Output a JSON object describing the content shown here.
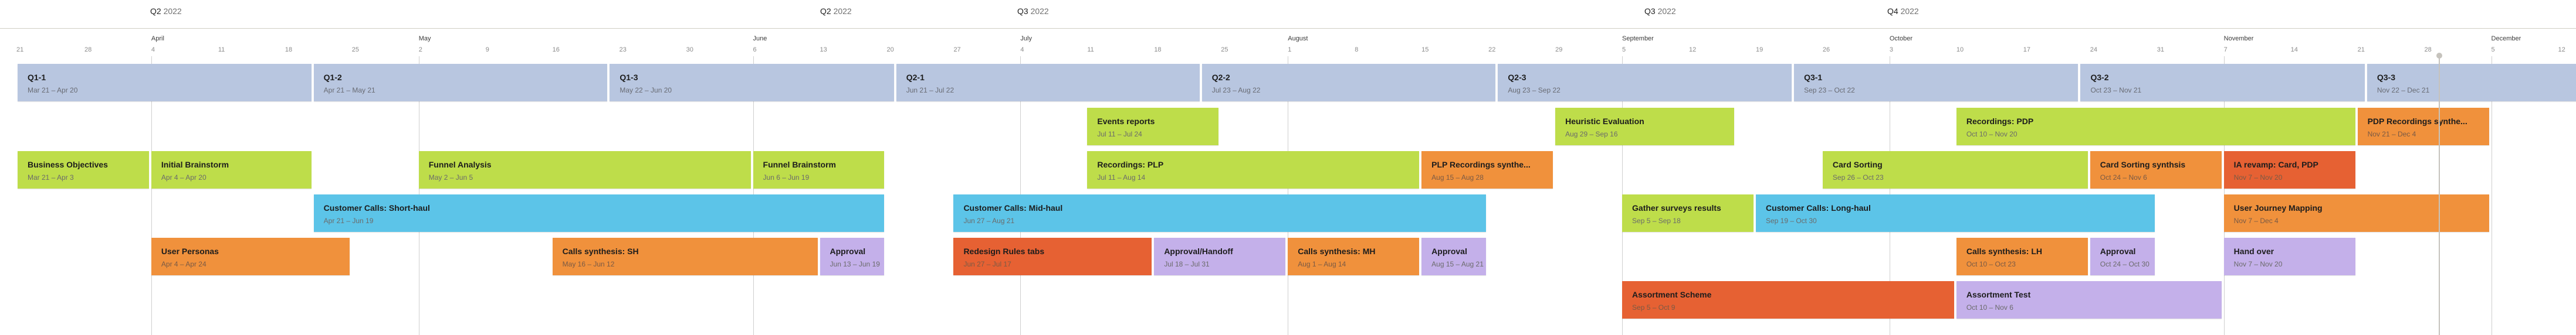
{
  "timeline": {
    "origin_date": "Mar 21",
    "colors": {
      "sprint": "#b8c6e0",
      "green": "#bedd4a",
      "blue": "#5cc4e8",
      "orange": "#f0913c",
      "red": "#e66133",
      "purple": "#c4b0ea"
    },
    "quarters": [
      {
        "q": "Q2",
        "year": "2022",
        "day": 0
      },
      {
        "q": "Q2",
        "year": "2022",
        "day": 77
      },
      {
        "q": "Q3",
        "year": "2022",
        "day": 105
      },
      {
        "q": "Q3",
        "year": "2022",
        "day": 182
      },
      {
        "q": "Q4",
        "year": "2022",
        "day": 196
      }
    ],
    "months": [
      {
        "label": "April",
        "day": 14
      },
      {
        "label": "May",
        "day": 42
      },
      {
        "label": "June",
        "day": 77
      },
      {
        "label": "July",
        "day": 105
      },
      {
        "label": "August",
        "day": 133
      },
      {
        "label": "September",
        "day": 168
      },
      {
        "label": "October",
        "day": 196
      },
      {
        "label": "November",
        "day": 231
      },
      {
        "label": "December",
        "day": 259
      }
    ],
    "weeks": [
      "21",
      "28",
      "4",
      "11",
      "18",
      "25",
      "2",
      "9",
      "16",
      "23",
      "30",
      "6",
      "13",
      "20",
      "27",
      "4",
      "11",
      "18",
      "25",
      "1",
      "8",
      "15",
      "22",
      "29",
      "5",
      "12",
      "19",
      "26",
      "3",
      "10",
      "17",
      "24",
      "31",
      "7",
      "14",
      "21",
      "28",
      "5",
      "12"
    ],
    "today_day": 253,
    "sprints": [
      {
        "title": "Q1-1",
        "dates": "Mar 21 – Apr 20",
        "start": 0,
        "end": 30
      },
      {
        "title": "Q1-2",
        "dates": "Apr 21 – May 21",
        "start": 31,
        "end": 61
      },
      {
        "title": "Q1-3",
        "dates": "May 22 – Jun 20",
        "start": 62,
        "end": 91
      },
      {
        "title": "Q2-1",
        "dates": "Jun 21 – Jul 22",
        "start": 92,
        "end": 123
      },
      {
        "title": "Q2-2",
        "dates": "Jul 23 – Aug 22",
        "start": 124,
        "end": 154
      },
      {
        "title": "Q2-3",
        "dates": "Aug 23 – Sep 22",
        "start": 155,
        "end": 185
      },
      {
        "title": "Q3-1",
        "dates": "Sep 23 – Oct 22",
        "start": 186,
        "end": 215
      },
      {
        "title": "Q3-2",
        "dates": "Oct 23 – Nov 21",
        "start": 216,
        "end": 245
      },
      {
        "title": "Q3-3",
        "dates": "Nov 22 – Dec 21",
        "start": 246,
        "end": 275
      }
    ],
    "tasks": [
      {
        "title": "Events reports",
        "dates": "Jul 11 – Jul 24",
        "start": 112,
        "end": 125,
        "row": 1,
        "color": "green"
      },
      {
        "title": "Heuristic Evaluation",
        "dates": "Aug 29 – Sep 16",
        "start": 161,
        "end": 179,
        "row": 1,
        "color": "green"
      },
      {
        "title": "Recordings: PDP",
        "dates": "Oct 10 – Nov 20",
        "start": 203,
        "end": 244,
        "row": 1,
        "color": "green"
      },
      {
        "title": "PDP Recordings synthe...",
        "dates": "Nov 21 – Dec 4",
        "start": 245,
        "end": 258,
        "row": 1,
        "color": "orange"
      },
      {
        "title": "Business Objectives",
        "dates": "Mar 21 – Apr 3",
        "start": 0,
        "end": 13,
        "row": 2,
        "color": "green"
      },
      {
        "title": "Initial Brainstorm",
        "dates": "Apr 4 – Apr 20",
        "start": 14,
        "end": 30,
        "row": 2,
        "color": "green"
      },
      {
        "title": "Funnel Analysis",
        "dates": "May 2 – Jun 5",
        "start": 42,
        "end": 76,
        "row": 2,
        "color": "green"
      },
      {
        "title": "Funnel Brainstorm",
        "dates": "Jun 6 – Jun 19",
        "start": 77,
        "end": 90,
        "row": 2,
        "color": "green"
      },
      {
        "title": "Recordings: PLP",
        "dates": "Jul 11 – Aug 14",
        "start": 112,
        "end": 146,
        "row": 2,
        "color": "green"
      },
      {
        "title": "PLP Recordings synthe...",
        "dates": "Aug 15 – Aug 28",
        "start": 147,
        "end": 160,
        "row": 2,
        "color": "orange"
      },
      {
        "title": "Card Sorting",
        "dates": "Sep 26 – Oct 23",
        "start": 189,
        "end": 216,
        "row": 2,
        "color": "green"
      },
      {
        "title": "Card Sorting synthsis",
        "dates": "Oct 24 – Nov 6",
        "start": 217,
        "end": 230,
        "row": 2,
        "color": "orange"
      },
      {
        "title": "IA revamp: Card, PDP",
        "dates": "Nov 7 – Nov 20",
        "start": 231,
        "end": 244,
        "row": 2,
        "color": "red"
      },
      {
        "title": "Customer Calls: Short-haul",
        "dates": "Apr 21 – Jun 19",
        "start": 31,
        "end": 90,
        "row": 3,
        "color": "blue"
      },
      {
        "title": "Customer Calls: Mid-haul",
        "dates": "Jun 27 – Aug 21",
        "start": 98,
        "end": 153,
        "row": 3,
        "color": "blue"
      },
      {
        "title": "Gather surveys results",
        "dates": "Sep 5 – Sep 18",
        "start": 168,
        "end": 181,
        "row": 3,
        "color": "green"
      },
      {
        "title": "Customer Calls: Long-haul",
        "dates": "Sep 19 – Oct 30",
        "start": 182,
        "end": 223,
        "row": 3,
        "color": "blue"
      },
      {
        "title": "User Journey Mapping",
        "dates": "Nov 7 – Dec 4",
        "start": 231,
        "end": 258,
        "row": 3,
        "color": "orange"
      },
      {
        "title": "User Personas",
        "dates": "Apr 4 – Apr 24",
        "start": 14,
        "end": 34,
        "row": 4,
        "color": "orange"
      },
      {
        "title": "Calls synthesis: SH",
        "dates": "May 16 – Jun 12",
        "start": 56,
        "end": 83,
        "row": 4,
        "color": "orange"
      },
      {
        "title": "Approval",
        "dates": "Jun 13 – Jun 19",
        "start": 84,
        "end": 90,
        "row": 4,
        "color": "purple"
      },
      {
        "title": "Redesign Rules tabs",
        "dates": "Jun 27 – Jul 17",
        "start": 98,
        "end": 118,
        "row": 4,
        "color": "red"
      },
      {
        "title": "Approval/Handoff",
        "dates": "Jul 18 – Jul 31",
        "start": 119,
        "end": 132,
        "row": 4,
        "color": "purple"
      },
      {
        "title": "Calls synthesis: MH",
        "dates": "Aug 1 – Aug 14",
        "start": 133,
        "end": 146,
        "row": 4,
        "color": "orange"
      },
      {
        "title": "Approval",
        "dates": "Aug 15 – Aug 21",
        "start": 147,
        "end": 153,
        "row": 4,
        "color": "purple"
      },
      {
        "title": "Calls synthesis: LH",
        "dates": "Oct 10 – Oct 23",
        "start": 203,
        "end": 216,
        "row": 4,
        "color": "orange"
      },
      {
        "title": "Approval",
        "dates": "Oct 24 – Oct 30",
        "start": 217,
        "end": 223,
        "row": 4,
        "color": "purple"
      },
      {
        "title": "Hand over",
        "dates": "Nov 7 – Nov 20",
        "start": 231,
        "end": 244,
        "row": 4,
        "color": "purple"
      },
      {
        "title": "Assortment Scheme",
        "dates": "Sep 5 – Oct 9",
        "start": 168,
        "end": 202,
        "row": 5,
        "color": "red"
      },
      {
        "title": "Assortment Test",
        "dates": "Oct 10 – Nov 6",
        "start": 203,
        "end": 230,
        "row": 5,
        "color": "purple"
      }
    ]
  }
}
